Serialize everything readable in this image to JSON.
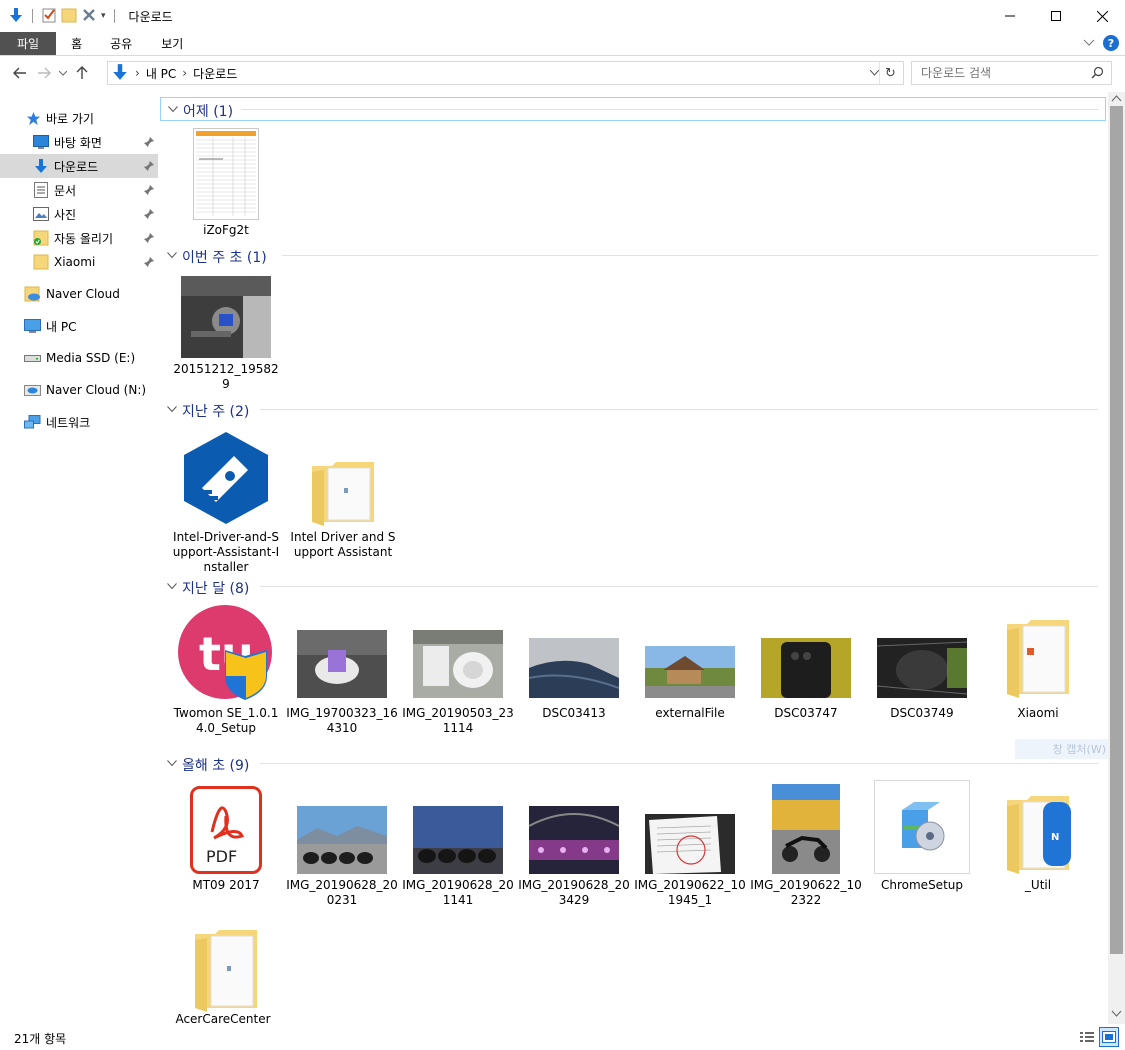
{
  "window": {
    "title": "다운로드",
    "buttons": {
      "minimize": "—",
      "maximize": "☐",
      "close": "✕"
    }
  },
  "ribbon": {
    "tabs": [
      "파일",
      "홈",
      "공유",
      "보기"
    ],
    "help": "?"
  },
  "address": {
    "crumbs": [
      "내 PC",
      "다운로드"
    ],
    "search_placeholder": "다운로드 검색"
  },
  "nav": {
    "items": [
      {
        "label": "바로 가기",
        "icon": "star-icon"
      },
      {
        "label": "바탕 화면",
        "icon": "desktop-icon",
        "pinned": true
      },
      {
        "label": "다운로드",
        "icon": "download-arrow-icon",
        "pinned": true,
        "selected": true
      },
      {
        "label": "문서",
        "icon": "document-icon",
        "pinned": true
      },
      {
        "label": "사진",
        "icon": "pictures-icon",
        "pinned": true
      },
      {
        "label": "자동 올리기",
        "icon": "folder-sync-icon",
        "pinned": true
      },
      {
        "label": "Xiaomi",
        "icon": "folder-icon",
        "pinned": true
      },
      {
        "label": "Naver Cloud",
        "icon": "cloud-folder-icon"
      },
      {
        "label": "내 PC",
        "icon": "computer-icon"
      },
      {
        "label": "Media SSD (E:)",
        "icon": "drive-icon"
      },
      {
        "label": "Naver Cloud (N:)",
        "icon": "cloud-drive-icon"
      },
      {
        "label": "네트워크",
        "icon": "network-icon"
      }
    ]
  },
  "groups": [
    {
      "header": "어제 (1)",
      "items": [
        {
          "name": "iZoFg2t",
          "kind": "spreadsheet"
        }
      ]
    },
    {
      "header": "이번 주 초 (1)",
      "items": [
        {
          "name": "20151212_195829",
          "kind": "photo-engine"
        }
      ]
    },
    {
      "header": "지난 주 (2)",
      "items": [
        {
          "name": "Intel-Driver-and-Support-Assistant-Installer",
          "kind": "intel-app"
        },
        {
          "name": "Intel Driver and Support Assistant",
          "kind": "folder"
        }
      ]
    },
    {
      "header": "지난 달 (8)",
      "items": [
        {
          "name": "Twomon SE_1.0.14.0_Setup",
          "kind": "twomon"
        },
        {
          "name": "IMG_19700323_164310",
          "kind": "photo-charger"
        },
        {
          "name": "IMG_20190503_231114",
          "kind": "photo-cable"
        },
        {
          "name": "DSC03413",
          "kind": "photo-shoe"
        },
        {
          "name": "externalFile",
          "kind": "photo-house"
        },
        {
          "name": "DSC03747",
          "kind": "photo-phone"
        },
        {
          "name": "DSC03749",
          "kind": "photo-board"
        },
        {
          "name": "Xiaomi",
          "kind": "folder-mi"
        }
      ]
    },
    {
      "header": "올해 초 (9)",
      "items": [
        {
          "name": "MT09 2017",
          "kind": "pdf"
        },
        {
          "name": "IMG_20190628_200231",
          "kind": "photo-bikes1"
        },
        {
          "name": "IMG_20190628_201141",
          "kind": "photo-bikes2"
        },
        {
          "name": "IMG_20190628_203429",
          "kind": "photo-night"
        },
        {
          "name": "IMG_20190622_101945_1",
          "kind": "photo-paper"
        },
        {
          "name": "IMG_20190622_102322",
          "kind": "photo-moto"
        },
        {
          "name": "ChromeSetup",
          "kind": "installer"
        },
        {
          "name": "_Util",
          "kind": "folder-util"
        },
        {
          "name": "AcerCareCenter_",
          "kind": "folder"
        }
      ]
    }
  ],
  "overlay_hint": "창 캡처(W)",
  "status": {
    "count": "21개 항목"
  },
  "colors": {
    "accent": "#1e3287",
    "selection": "#d9d9d9",
    "folder": "#f6d67a"
  }
}
